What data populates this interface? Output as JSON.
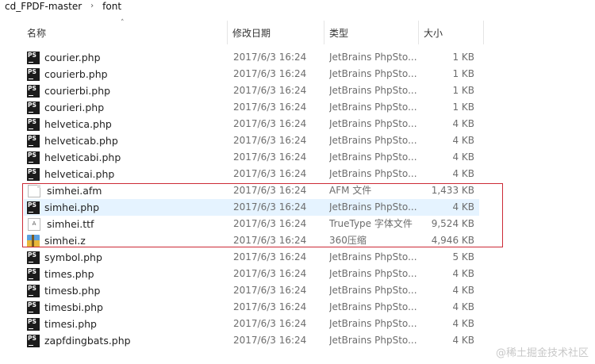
{
  "breadcrumb": [
    "cd_FPDF-master",
    "font"
  ],
  "columns": {
    "name": "名称",
    "date": "修改日期",
    "type": "类型",
    "size": "大小"
  },
  "files": [
    {
      "name": "courier.php",
      "date": "2017/6/3 16:24",
      "type": "JetBrains PhpSto...",
      "size": "1 KB",
      "icon": "php-icon",
      "selected": false
    },
    {
      "name": "courierb.php",
      "date": "2017/6/3 16:24",
      "type": "JetBrains PhpSto...",
      "size": "1 KB",
      "icon": "php-icon",
      "selected": false
    },
    {
      "name": "courierbi.php",
      "date": "2017/6/3 16:24",
      "type": "JetBrains PhpSto...",
      "size": "1 KB",
      "icon": "php-icon",
      "selected": false
    },
    {
      "name": "courieri.php",
      "date": "2017/6/3 16:24",
      "type": "JetBrains PhpSto...",
      "size": "1 KB",
      "icon": "php-icon",
      "selected": false
    },
    {
      "name": "helvetica.php",
      "date": "2017/6/3 16:24",
      "type": "JetBrains PhpSto...",
      "size": "4 KB",
      "icon": "php-icon",
      "selected": false
    },
    {
      "name": "helveticab.php",
      "date": "2017/6/3 16:24",
      "type": "JetBrains PhpSto...",
      "size": "4 KB",
      "icon": "php-icon",
      "selected": false
    },
    {
      "name": "helveticabi.php",
      "date": "2017/6/3 16:24",
      "type": "JetBrains PhpSto...",
      "size": "4 KB",
      "icon": "php-icon",
      "selected": false
    },
    {
      "name": "helveticai.php",
      "date": "2017/6/3 16:24",
      "type": "JetBrains PhpSto...",
      "size": "4 KB",
      "icon": "php-icon",
      "selected": false
    },
    {
      "name": "simhei.afm",
      "date": "2017/6/3 16:24",
      "type": "AFM 文件",
      "size": "1,433 KB",
      "icon": "document-icon",
      "selected": false
    },
    {
      "name": "simhei.php",
      "date": "2017/6/3 16:24",
      "type": "JetBrains PhpSto...",
      "size": "4 KB",
      "icon": "php-icon",
      "selected": true
    },
    {
      "name": "simhei.ttf",
      "date": "2017/6/3 16:24",
      "type": "TrueType 字体文件",
      "size": "9,524 KB",
      "icon": "font-file-icon",
      "selected": false
    },
    {
      "name": "simhei.z",
      "date": "2017/6/3 16:24",
      "type": "360压缩",
      "size": "4,946 KB",
      "icon": "archive-icon",
      "selected": false
    },
    {
      "name": "symbol.php",
      "date": "2017/6/3 16:24",
      "type": "JetBrains PhpSto...",
      "size": "5 KB",
      "icon": "php-icon",
      "selected": false
    },
    {
      "name": "times.php",
      "date": "2017/6/3 16:24",
      "type": "JetBrains PhpSto...",
      "size": "4 KB",
      "icon": "php-icon",
      "selected": false
    },
    {
      "name": "timesb.php",
      "date": "2017/6/3 16:24",
      "type": "JetBrains PhpSto...",
      "size": "4 KB",
      "icon": "php-icon",
      "selected": false
    },
    {
      "name": "timesbi.php",
      "date": "2017/6/3 16:24",
      "type": "JetBrains PhpSto...",
      "size": "4 KB",
      "icon": "php-icon",
      "selected": false
    },
    {
      "name": "timesi.php",
      "date": "2017/6/3 16:24",
      "type": "JetBrains PhpSto...",
      "size": "4 KB",
      "icon": "php-icon",
      "selected": false
    },
    {
      "name": "zapfdingbats.php",
      "date": "2017/6/3 16:24",
      "type": "JetBrains PhpSto...",
      "size": "4 KB",
      "icon": "php-icon",
      "selected": false
    }
  ],
  "watermark": "@稀土掘金技术社区",
  "colors": {
    "highlight_border": "#cc2a36",
    "selected_row": "#e5f3ff",
    "meta_text": "#6d6d6d"
  }
}
